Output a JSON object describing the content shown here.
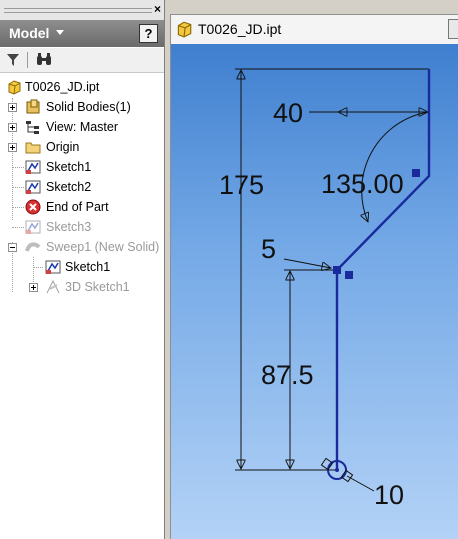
{
  "browser": {
    "title": "Model",
    "close_glyph": "×",
    "help_glyph": "?",
    "toolbar": {
      "filter_icon": "filter-icon",
      "find_icon": "binoculars-icon"
    },
    "tree": [
      {
        "label": "T0026_JD.ipt",
        "icon": "part-icon",
        "dimmed": false
      },
      {
        "label": "Solid Bodies(1)",
        "icon": "solid-bodies-icon",
        "dimmed": false
      },
      {
        "label": "View: Master",
        "icon": "view-icon",
        "dimmed": false
      },
      {
        "label": "Origin",
        "icon": "folder-icon",
        "dimmed": false
      },
      {
        "label": "Sketch1",
        "icon": "sketch-icon",
        "dimmed": false
      },
      {
        "label": "Sketch2",
        "icon": "sketch-icon",
        "dimmed": false
      },
      {
        "label": "End of Part",
        "icon": "end-of-part-icon",
        "dimmed": false
      },
      {
        "label": "Sketch3",
        "icon": "sketch-icon",
        "dimmed": true
      },
      {
        "label": "Sweep1 (New Solid)",
        "icon": "sweep-icon",
        "dimmed": true
      },
      {
        "label": "Sketch1",
        "icon": "sketch-icon",
        "dimmed": false
      },
      {
        "label": "3D Sketch1",
        "icon": "3d-sketch-icon",
        "dimmed": true
      }
    ]
  },
  "document": {
    "tab_title": "T0026_JD.ipt"
  },
  "sketch": {
    "dimensions": {
      "top_width": "40",
      "height_total": "175",
      "angle": "135.00",
      "fillet": "5",
      "lower_height": "87.5",
      "bottom": "10"
    },
    "colors": {
      "geometry": "#1a2a9c",
      "dimension_lines": "#000000",
      "background_top": "#3f7fcf",
      "background_bottom": "#b3d2f6"
    }
  }
}
